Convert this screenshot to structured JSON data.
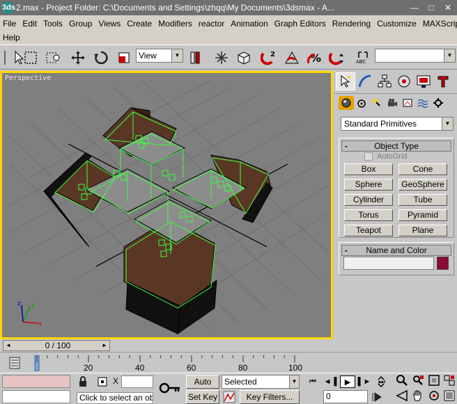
{
  "window": {
    "app_icon": "3ds",
    "title": "2.max   - Project Folder: C:\\Documents and Settings\\zhqq\\My Documents\\3dsmax    - A...",
    "min": "—",
    "max": "□",
    "close": "✕"
  },
  "menu": {
    "row1": [
      "File",
      "Edit",
      "Tools",
      "Group",
      "Views",
      "Create",
      "Modifiers",
      "reactor",
      "Animation",
      "Graph Editors",
      "Rendering",
      "Customize",
      "MAXScript"
    ],
    "row2": [
      "Help"
    ]
  },
  "toolbar": {
    "refcoord_value": "View",
    "named_selection_value": "",
    "abc_label": "ABC"
  },
  "viewport": {
    "label": "Perspective",
    "axis_x": "x",
    "axis_y": "y",
    "axis_z": "z"
  },
  "command_panel": {
    "category_value": "Standard Primitives",
    "object_type": {
      "title": "Object Type",
      "minus": "-",
      "autogrid": "AutoGrid",
      "buttons": [
        "Box",
        "Cone",
        "Sphere",
        "GeoSphere",
        "Cylinder",
        "Tube",
        "Torus",
        "Pyramid",
        "Teapot",
        "Plane"
      ]
    },
    "name_color": {
      "title": "Name and Color",
      "minus": "-",
      "swatch_color": "#8b0b3a"
    }
  },
  "timeline": {
    "frame_label": "0 / 100",
    "prev": "◄",
    "next": "►",
    "ticks": [
      "20",
      "40",
      "60",
      "80",
      "100"
    ]
  },
  "status": {
    "prompt": "Click to select an obje",
    "x_label": "X",
    "auto_key": "Auto Key",
    "set_key": "Set Key",
    "key_mode": "Selected",
    "key_filters": "Key Filters...",
    "current_frame": "0"
  }
}
